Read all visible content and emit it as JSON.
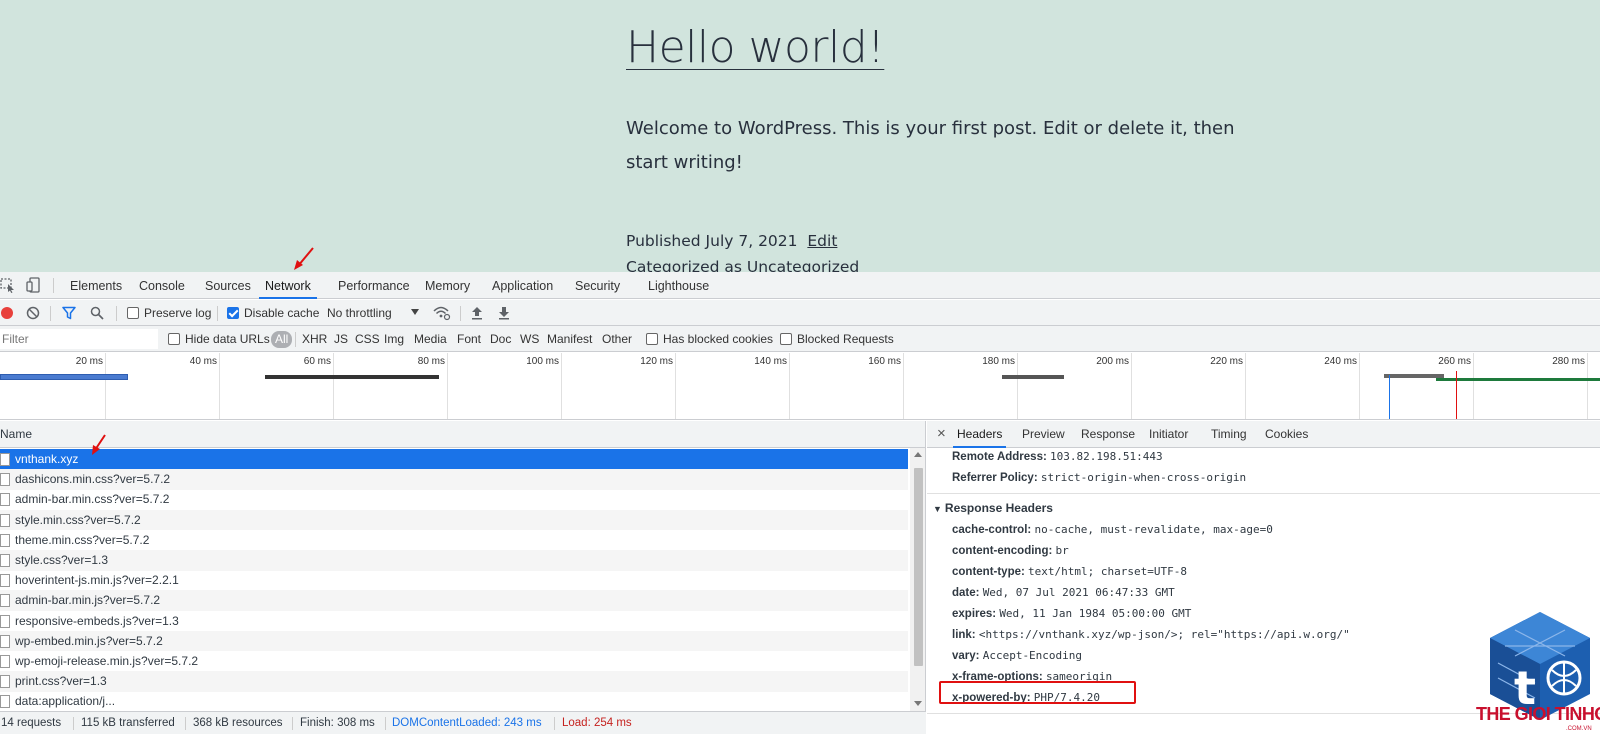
{
  "webpage": {
    "title": "Hello world!",
    "body": "Welcome to WordPress. This is your first post. Edit or delete it, then start writing!",
    "published_prefix": "Published July 7, 2021",
    "edit_link": "Edit",
    "category_prefix": "Categorized as",
    "category_link": "Uncategorized"
  },
  "devtools": {
    "tabs": [
      "Elements",
      "Console",
      "Sources",
      "Network",
      "Performance",
      "Memory",
      "Application",
      "Security",
      "Lighthouse"
    ],
    "active_tab": "Network",
    "toolbar": {
      "preserve_log": "Preserve log",
      "preserve_log_checked": false,
      "disable_cache": "Disable cache",
      "disable_cache_checked": true,
      "throttling": "No throttling"
    },
    "filterbar": {
      "filter_placeholder": "Filter",
      "hide_data_urls": "Hide data URLs",
      "types": [
        "All",
        "XHR",
        "JS",
        "CSS",
        "Img",
        "Media",
        "Font",
        "Doc",
        "WS",
        "Manifest",
        "Other"
      ],
      "has_blocked_cookies": "Has blocked cookies",
      "blocked_requests": "Blocked Requests"
    },
    "overview_ticks": [
      "20 ms",
      "40 ms",
      "60 ms",
      "80 ms",
      "100 ms",
      "120 ms",
      "140 ms",
      "160 ms",
      "180 ms",
      "200 ms",
      "220 ms",
      "240 ms",
      "260 ms",
      "280 ms"
    ],
    "request_list": {
      "column_header": "Name",
      "rows": [
        "vnthank.xyz",
        "dashicons.min.css?ver=5.7.2",
        "admin-bar.min.css?ver=5.7.2",
        "style.min.css?ver=5.7.2",
        "theme.min.css?ver=5.7.2",
        "style.css?ver=1.3",
        "hoverintent-js.min.js?ver=2.2.1",
        "admin-bar.min.js?ver=5.7.2",
        "responsive-embeds.js?ver=1.3",
        "wp-embed.min.js?ver=5.7.2",
        "wp-emoji-release.min.js?ver=5.7.2",
        "print.css?ver=1.3",
        "data:application/j..."
      ],
      "selected_index": 0
    },
    "statusbar": {
      "requests": "14 requests",
      "transferred": "115 kB transferred",
      "resources": "368 kB resources",
      "finish": "Finish: 308 ms",
      "dom_content_loaded": "DOMContentLoaded: 243 ms",
      "load": "Load: 254 ms"
    },
    "detail": {
      "close": "×",
      "tabs": [
        "Headers",
        "Preview",
        "Response",
        "Initiator",
        "Timing",
        "Cookies"
      ],
      "active_tab": "Headers",
      "general": [
        {
          "name": "Remote Address:",
          "value": "103.82.198.51:443"
        },
        {
          "name": "Referrer Policy:",
          "value": "strict-origin-when-cross-origin"
        }
      ],
      "response_headers_title": "Response Headers",
      "response_headers": [
        {
          "name": "cache-control:",
          "value": "no-cache, must-revalidate, max-age=0"
        },
        {
          "name": "content-encoding:",
          "value": "br"
        },
        {
          "name": "content-type:",
          "value": "text/html; charset=UTF-8"
        },
        {
          "name": "date:",
          "value": "Wed, 07 Jul 2021 06:47:33 GMT"
        },
        {
          "name": "expires:",
          "value": "Wed, 11 Jan 1984 05:00:00 GMT"
        },
        {
          "name": "link:",
          "value": "<https://vnthank.xyz/wp-json/>; rel=\"https://api.w.org/\""
        },
        {
          "name": "vary:",
          "value": "Accept-Encoding"
        },
        {
          "name": "x-frame-options:",
          "value": "sameorigin"
        },
        {
          "name": "x-powered-by:",
          "value": "PHP/7.4.20"
        }
      ]
    }
  },
  "watermark": {
    "text_part1": "THE GIOI",
    "text_part2": "TINHOC",
    "text_small": ".COM.VN"
  },
  "colors": {
    "page_bg": "#d1e4dd",
    "accent_blue": "#1a73e8",
    "annotation_red": "#e01010",
    "record_red": "#e8403b"
  }
}
